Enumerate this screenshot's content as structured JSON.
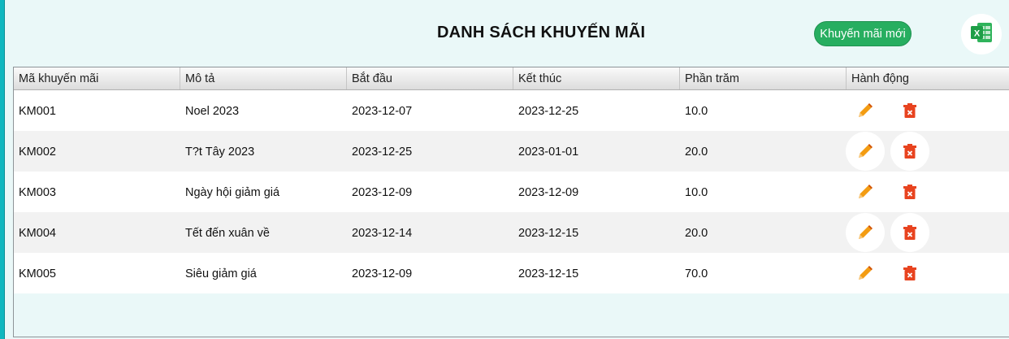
{
  "header": {
    "title": "DANH SÁCH KHUYẾN MÃI",
    "new_button_label": "Khuyến mãi mới"
  },
  "colors": {
    "accent": "#27ae60",
    "side_bar": "#10b7bf",
    "edit_icon": "#f39c12",
    "delete_icon": "#e8431f",
    "excel": "#1e9e47"
  },
  "icons": {
    "export": "excel-icon",
    "edit": "pencil-icon",
    "delete": "trash-icon"
  },
  "table": {
    "columns": [
      "Mã khuyến mãi",
      "Mô tả",
      "Bắt đầu",
      "Kết thúc",
      "Phần trăm",
      "Hành động"
    ],
    "rows": [
      [
        "KM001",
        "Noel 2023",
        "2023-12-07",
        "2023-12-25",
        "10.0"
      ],
      [
        "KM002",
        "T?t Tây 2023",
        "2023-12-25",
        "2023-01-01",
        "20.0"
      ],
      [
        "KM003",
        "Ngày hội giảm giá",
        "2023-12-09",
        "2023-12-09",
        "10.0"
      ],
      [
        "KM004",
        "Tết đến xuân về",
        "2023-12-14",
        "2023-12-15",
        "20.0"
      ],
      [
        "KM005",
        "Siêu giảm giá",
        "2023-12-09",
        "2023-12-15",
        "70.0"
      ]
    ]
  }
}
